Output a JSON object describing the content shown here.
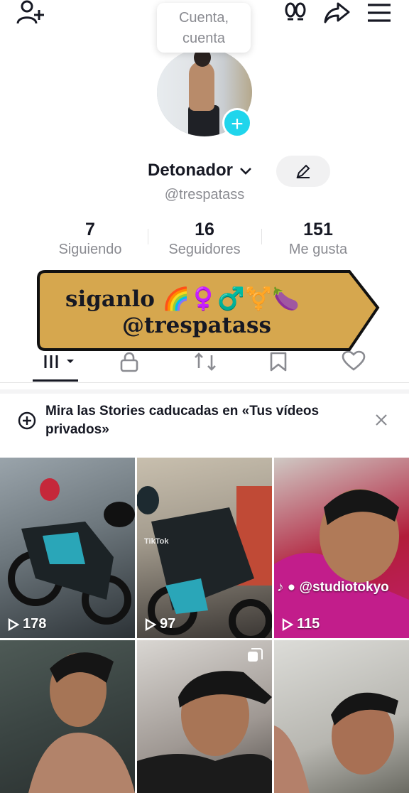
{
  "tooltip": {
    "line1": "Cuenta,",
    "line2": "cuenta"
  },
  "profile": {
    "username": "Detonador",
    "handle": "@trespatass",
    "stats": [
      {
        "value": "7",
        "label": "Siguiendo"
      },
      {
        "value": "16",
        "label": "Seguidores"
      },
      {
        "value": "151",
        "label": "Me gusta"
      }
    ]
  },
  "banner": {
    "line1": "siganlo 🌈♀️♂️⚧️🍆",
    "line2": "@trespatass",
    "color": "#d6a74e"
  },
  "notice": {
    "text": "Mira las Stories caducadas en «Tus vídeos privados»"
  },
  "videos": [
    {
      "views": "178"
    },
    {
      "views": "97",
      "watermark": "TikTok"
    },
    {
      "views": "115",
      "overlay": "@studiotokyo"
    },
    {
      "views": ""
    },
    {
      "views": ""
    },
    {
      "views": ""
    }
  ],
  "colors": {
    "accent": "#20d5ec",
    "text": "#161823",
    "muted": "#8a8b91"
  }
}
